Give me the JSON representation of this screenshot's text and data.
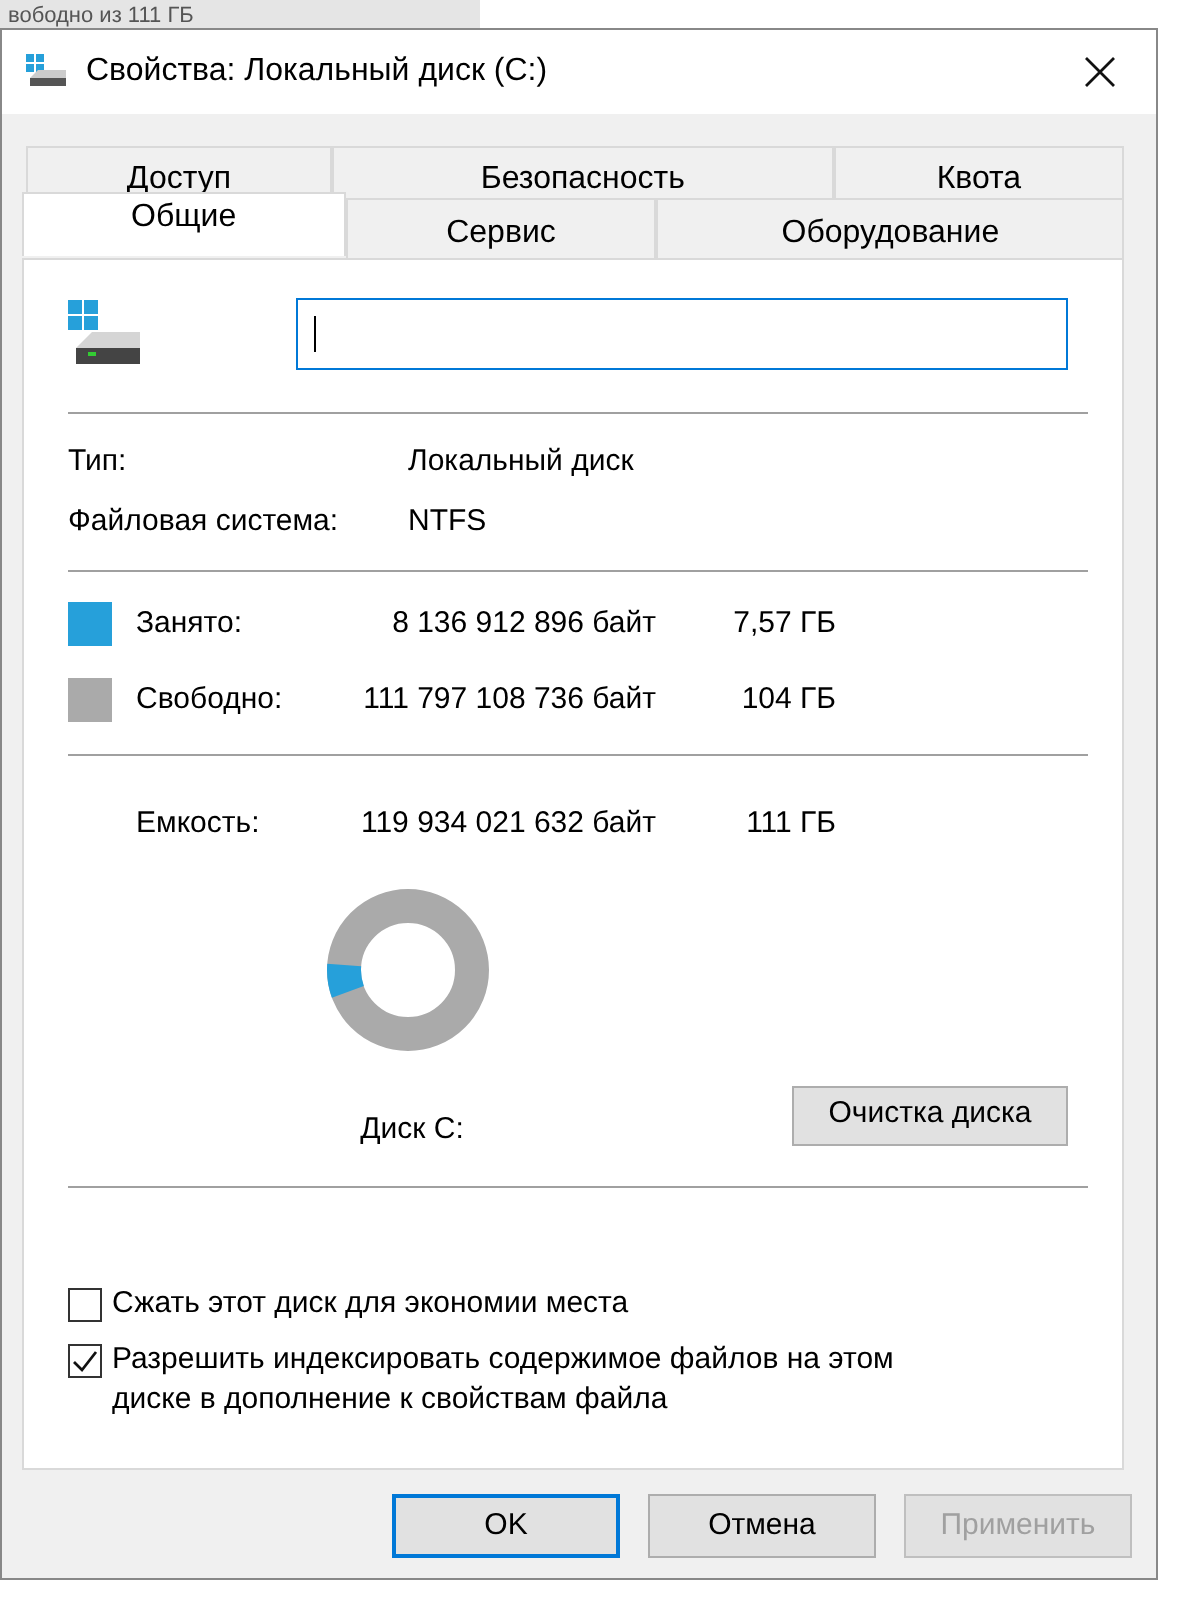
{
  "background_window": {
    "text": "вободно из 111 ГБ"
  },
  "window": {
    "title": "Свойства: Локальный диск (C:)"
  },
  "tabs_back": [
    {
      "label": "Доступ",
      "selected": false
    },
    {
      "label": "Безопасность",
      "selected": false
    },
    {
      "label": "Квота",
      "selected": false
    }
  ],
  "tabs_front": [
    {
      "label": "Общие",
      "selected": true
    },
    {
      "label": "Сервис",
      "selected": false
    },
    {
      "label": "Оборудование",
      "selected": false
    }
  ],
  "info": [
    {
      "label": "Тип:",
      "value": "Локальный диск"
    },
    {
      "label": "Файловая система:",
      "value": "NTFS"
    }
  ],
  "usage": [
    {
      "label": "Занято:",
      "bytes": "8 136 912 896 байт",
      "size": "7,57 ГБ",
      "color": "#26a0da"
    },
    {
      "label": "Свободно:",
      "bytes": "111 797 108 736 байт",
      "size": "104 ГБ",
      "color": "#aaaaaa"
    }
  ],
  "capacity": {
    "label": "Емкость:",
    "bytes": "119 934 021 632 байт",
    "size": "111 ГБ"
  },
  "donut": {
    "level": 0.068
  },
  "drive_label": "Диск C:",
  "cleanup_button": "Очистка диска",
  "options": [
    {
      "label": "Сжать этот диск для экономии места",
      "checked": false
    },
    {
      "label": "Разрешить индексировать содержимое файлов на этом диске в дополнение к свойствам файла",
      "checked": true
    }
  ],
  "buttons": [
    {
      "label": "OK",
      "kind": "default",
      "disabled": false
    },
    {
      "label": "Отмена",
      "kind": "normal",
      "disabled": false
    },
    {
      "label": "Применить",
      "kind": "normal",
      "disabled": true
    }
  ]
}
